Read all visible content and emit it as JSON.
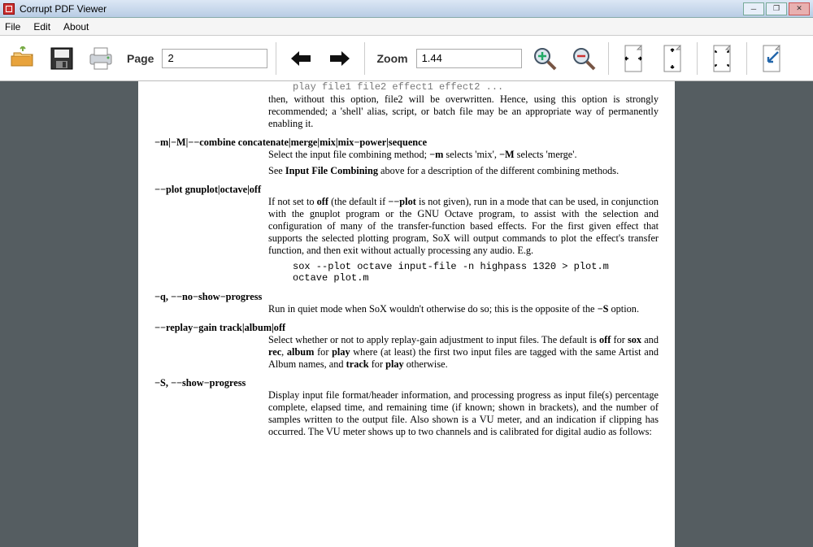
{
  "window": {
    "title": "Corrupt PDF Viewer",
    "min_label": "─",
    "max_label": "❐",
    "close_label": "✕"
  },
  "menu": {
    "file": "File",
    "edit": "Edit",
    "about": "About"
  },
  "toolbar": {
    "page_label": "Page",
    "page_value": "2",
    "zoom_label": "Zoom",
    "zoom_value": "1.44"
  },
  "doc": {
    "line_top_code": "play file1 file2 effect1 effect2 ...",
    "para_overwrite": "then, without this option, file2 will be overwritten.  Hence, using this option is strongly recommended; a 'shell' alias, script, or batch file may be an appropriate way of permanently enabling it.",
    "opt_m_head": "−m|−M|−−combine concatenate|merge|mix|mix−power|sequence",
    "opt_m_body1a": "Select the input file combining method; ",
    "opt_m_body1b": " selects 'mix', ",
    "opt_m_body1c": " selects 'merge'.",
    "opt_m_bold_m": "−m",
    "opt_m_bold_M": "−M",
    "opt_m_body2a": "See ",
    "opt_m_body2b": "Input File Combining",
    "opt_m_body2c": " above for a description of the different combining methods.",
    "opt_plot_head": "−−plot gnuplot|octave|off",
    "opt_plot_a": "If not set to ",
    "opt_plot_off": "off",
    "opt_plot_b": " (the default if ",
    "opt_plot_flag": "−−plot",
    "opt_plot_c": " is not given), run in a mode that can be used, in conjunction with the gnuplot program or the GNU Octave program, to assist with the selection and configuration of many of the transfer-function based effects.  For the first given effect that supports the selected plotting program, SoX will output commands to plot the effect's transfer function, and then exit without actually processing any audio.  E.g.",
    "opt_plot_code1": "sox --plot octave input-file -n highpass 1320 > plot.m",
    "opt_plot_code2": "octave plot.m",
    "opt_q_head": "−q, −−no−show−progress",
    "opt_q_a": "Run in quiet mode when SoX wouldn't otherwise do so; this is the opposite of the ",
    "opt_q_S": "−S",
    "opt_q_b": " option.",
    "opt_rg_head": "−−replay−gain track|album|off",
    "opt_rg_a": "Select whether or not to apply replay-gain adjustment to input files.  The default is ",
    "opt_rg_off": "off",
    "opt_rg_b": " for ",
    "opt_rg_sox": "sox",
    "opt_rg_c": " and ",
    "opt_rg_rec": "rec",
    "opt_rg_d": ", ",
    "opt_rg_album": "album",
    "opt_rg_e": " for ",
    "opt_rg_play1": "play",
    "opt_rg_f": " where (at least) the first two input files are tagged with the same Artist and Album names, and ",
    "opt_rg_track": "track",
    "opt_rg_g": " for ",
    "opt_rg_play2": "play",
    "opt_rg_h": " otherwise.",
    "opt_S_head": "−S, −−show−progress",
    "opt_S_body": "Display input file format/header information, and processing progress as input file(s) percentage complete, elapsed time, and remaining time (if known; shown in brackets), and the number of samples written to the output file.  Also shown is a VU meter, and an indication if clipping has occurred.  The VU meter shows up to two channels and is calibrated for digital audio as follows:"
  }
}
